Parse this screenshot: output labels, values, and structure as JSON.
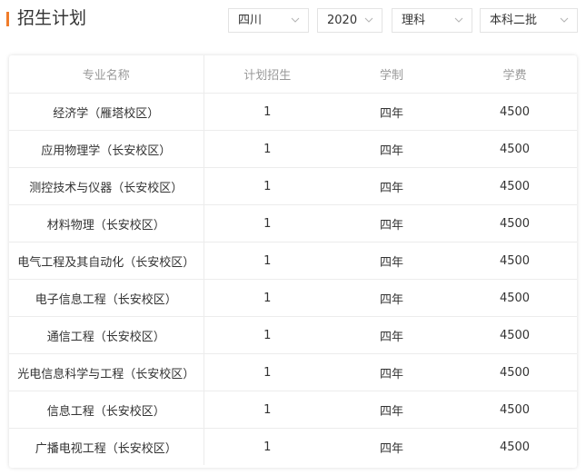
{
  "header": {
    "title": "招生计划"
  },
  "filters": {
    "province": "四川",
    "year": "2020",
    "subject": "理科",
    "batch": "本科二批"
  },
  "table": {
    "columns": [
      "专业名称",
      "计划招生",
      "学制",
      "学费"
    ],
    "rows": [
      {
        "major": "经济学（雁塔校区）",
        "plan": "1",
        "duration": "四年",
        "tuition": "4500"
      },
      {
        "major": "应用物理学（长安校区）",
        "plan": "1",
        "duration": "四年",
        "tuition": "4500"
      },
      {
        "major": "测控技术与仪器（长安校区）",
        "plan": "1",
        "duration": "四年",
        "tuition": "4500"
      },
      {
        "major": "材料物理（长安校区）",
        "plan": "1",
        "duration": "四年",
        "tuition": "4500"
      },
      {
        "major": "电气工程及其自动化（长安校区）",
        "plan": "1",
        "duration": "四年",
        "tuition": "4500"
      },
      {
        "major": "电子信息工程（长安校区）",
        "plan": "1",
        "duration": "四年",
        "tuition": "4500"
      },
      {
        "major": "通信工程（长安校区）",
        "plan": "1",
        "duration": "四年",
        "tuition": "4500"
      },
      {
        "major": "光电信息科学与工程（长安校区）",
        "plan": "1",
        "duration": "四年",
        "tuition": "4500"
      },
      {
        "major": "信息工程（长安校区）",
        "plan": "1",
        "duration": "四年",
        "tuition": "4500"
      },
      {
        "major": "广播电视工程（长安校区）",
        "plan": "1",
        "duration": "四年",
        "tuition": "4500"
      }
    ]
  },
  "colors": {
    "accent": "#f07c2a",
    "header_text": "#999999",
    "border": "#ececec"
  },
  "icons": {
    "dropdown": "chevron-down-icon"
  }
}
